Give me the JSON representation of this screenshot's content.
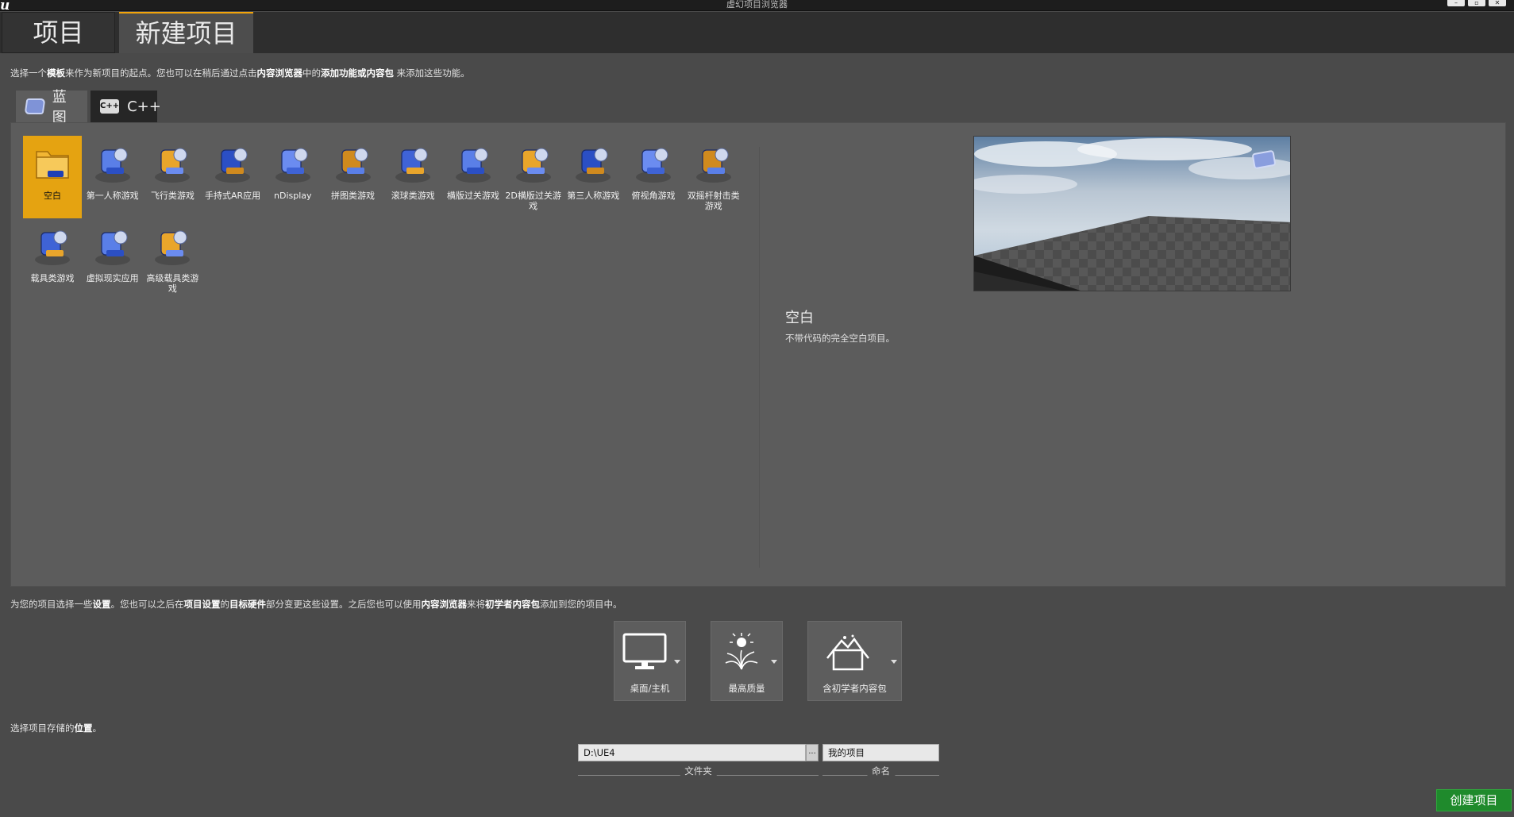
{
  "window": {
    "logo": "u",
    "title": "虚幻项目浏览器",
    "controls": [
      "–",
      "▫",
      "✕"
    ]
  },
  "tabs": {
    "projects": "项目",
    "new_project": "新建项目"
  },
  "template_hint": {
    "pre": "选择一个",
    "b1": "模板",
    "mid1": "来作为新项目的起点。您也可以在稍后通过点击",
    "b2": "内容浏览器",
    "mid2": "中的",
    "b3": "添加功能或内容包",
    "post": " 来添加这些功能。"
  },
  "subtabs": {
    "blueprint": "蓝图",
    "cpp": "C++",
    "cpp_icon_text": "C++"
  },
  "templates": [
    {
      "label": "空白",
      "icon": "blank-folder-icon",
      "selected": true
    },
    {
      "label": "第一人称游戏",
      "icon": "first-person-icon"
    },
    {
      "label": "飞行类游戏",
      "icon": "flying-icon"
    },
    {
      "label": "手持式AR应用",
      "icon": "handheld-ar-icon"
    },
    {
      "label": "nDisplay",
      "icon": "ndisplay-icon"
    },
    {
      "label": "拼图类游戏",
      "icon": "puzzle-icon"
    },
    {
      "label": "滚球类游戏",
      "icon": "rolling-ball-icon"
    },
    {
      "label": "横版过关游戏",
      "icon": "side-scroller-icon"
    },
    {
      "label": "2D横版过关游戏",
      "icon": "2d-side-scroller-icon"
    },
    {
      "label": "第三人称游戏",
      "icon": "third-person-icon"
    },
    {
      "label": "俯视角游戏",
      "icon": "top-down-icon"
    },
    {
      "label": "双摇杆射击类游戏",
      "icon": "twin-stick-icon"
    },
    {
      "label": "载具类游戏",
      "icon": "vehicle-icon"
    },
    {
      "label": "虚拟现实应用",
      "icon": "vr-headset-icon"
    },
    {
      "label": "高级载具类游戏",
      "icon": "advanced-vehicle-icon"
    }
  ],
  "preview": {
    "title": "空白",
    "description": "不带代码的完全空白项目。"
  },
  "settings_hint": {
    "pre": "为您的项目选择一些",
    "b1": "设置",
    "mid1": "。您也可以之后在",
    "b2": "项目设置",
    "mid2": "的",
    "b3": "目标硬件",
    "mid3": "部分变更这些设置。之后您也可以使用",
    "b4": "内容浏览器",
    "mid4": "来将",
    "b5": "初学者内容包",
    "post": "添加到您的项目中。"
  },
  "settings": {
    "hardware": "桌面/主机",
    "quality": "最高质量",
    "starter": "含初学者内容包"
  },
  "location_hint": {
    "pre": "选择项目存储的",
    "b1": "位置",
    "post": "。"
  },
  "location": {
    "folder_value": "D:\\UE4",
    "browse": "...",
    "folder_caption": "文件夹",
    "name_value": "我的项目",
    "name_caption": "命名"
  },
  "create_button": "创建项目",
  "colors": {
    "accent": "#e5a311",
    "create": "#1f8a2c",
    "panel": "#5c5c5c"
  }
}
